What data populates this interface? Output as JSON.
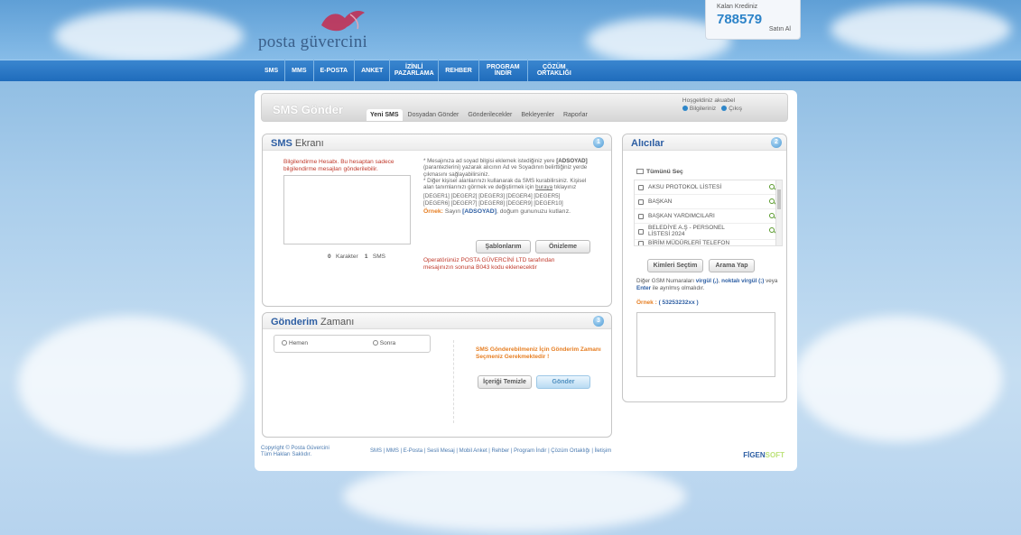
{
  "brand": {
    "logo_text": "posta güvercini"
  },
  "credit": {
    "label": "Kalan Krediniz",
    "value": "788579",
    "buy_label": "Satın Al"
  },
  "nav": [
    {
      "label": "SMS"
    },
    {
      "label": "MMS"
    },
    {
      "label": "E-POSTA"
    },
    {
      "label": "ANKET"
    },
    {
      "label": "İZİNLİ PAZARLAMA"
    },
    {
      "label": "REHBER"
    },
    {
      "label": "PROGRAM İNDİR"
    },
    {
      "label": "ÇÖZÜM ORTAKLIĞI"
    }
  ],
  "header": {
    "title": "SMS Gönder",
    "tabs": [
      "Yeni SMS",
      "Dosyadan Gönder",
      "Gönderilecekler",
      "Bekleyenler",
      "Raporlar"
    ],
    "welcome": "Hoşgeldiniz akuabel",
    "info_link": "Bilgileriniz",
    "logout_link": "Çıkış"
  },
  "sms_box": {
    "title_bold": "SMS",
    "title_rest": " Ekranı",
    "step": "1",
    "warning": "Bilgilendirme Hesabı. Bu hesaptan sadece bilgilendirme mesajları gönderilebilir.",
    "char_count": "0",
    "char_label": "Karakter",
    "sms_count": "1",
    "sms_label": "SMS",
    "info1": "* Mesajınıza ad soyad bilgisi eklemek istediğiniz yere",
    "adsoyad_tag": "[ADSOYAD]",
    "info2": "(parantezlerini) yazarak alıcının Ad ve Soyadının belirttiğiniz yerde çıkmasını sağlayabilirsiniz.",
    "info3": "* Diğer kişisel alanlarınızı kullanarak da SMS kurabilirsiniz. Kişisel alan tanımlarınızı görmek ve değiştirmek için",
    "info_link": "buraya",
    "info4": "tıklayınız",
    "fields1": "[DEGER1] [DEGER2] [DEGER3] [DEGER4] [DEGER5]",
    "fields2": "[DEGER6] [DEGER7] [DEGER8] [DEGER9] [DEGER10]",
    "example_label": "Örnek:",
    "example_text": "Sayın",
    "example_tag": "[ADSOYAD]",
    "example_rest": ", doğum gununuzu kutlarız.",
    "templates_button": "Şablonlarım",
    "preview_button": "Önizleme",
    "operator_note": "Operatörünüz POSTA GÜVERCİNİ LTD tarafından mesajınızın sonuna B043 kodu eklenecektir"
  },
  "schedule_box": {
    "title_bold": "Gönderim",
    "title_rest": " Zamanı",
    "step": "3",
    "now_label": "Hemen",
    "later_label": "Sonra",
    "notice": "SMS Gönderebilmeniz İçin Gönderim Zamanı Seçmeniz Gerekmektedir !",
    "clear_button": "İçeriği Temizle",
    "send_button": "Gönder"
  },
  "recipients_box": {
    "title": "Alıcılar",
    "step": "2",
    "select_all": "Tümünü Seç",
    "items": [
      "AKSU PROTOKOL LİSTESİ",
      "BAŞKAN",
      "BAŞKAN YARDIMCILARI",
      "BELEDİYE A.Ş - PERSONEL LİSTESİ 2024",
      "BİRİM MÜDÜRLERİ TELEFON"
    ],
    "who_button": "Kimleri Seçtim",
    "search_button": "Arama Yap",
    "help1": "Diğer GSM Numaraları",
    "help_comma": "virgül (,)",
    "help2": ",",
    "help_semicolon": "noktalı virgül (;)",
    "help3": "veya",
    "help_enter": "Enter",
    "help4": "ile ayrılmış olmalıdır.",
    "example_label": "Örnek :",
    "example_value": "( 53253232xx )"
  },
  "footer": {
    "copyright1": "Copyright © Posta Güvercini",
    "copyright2": "Tüm Hakları Saklıdır.",
    "links": "SMS | MMS | E-Posta | Sesli Mesaj | Mobil Anket | Rehber | Program İndir | Çözüm Ortaklığı | İletişim",
    "brand": "FİGEN",
    "brand_suffix": "SOFT"
  }
}
